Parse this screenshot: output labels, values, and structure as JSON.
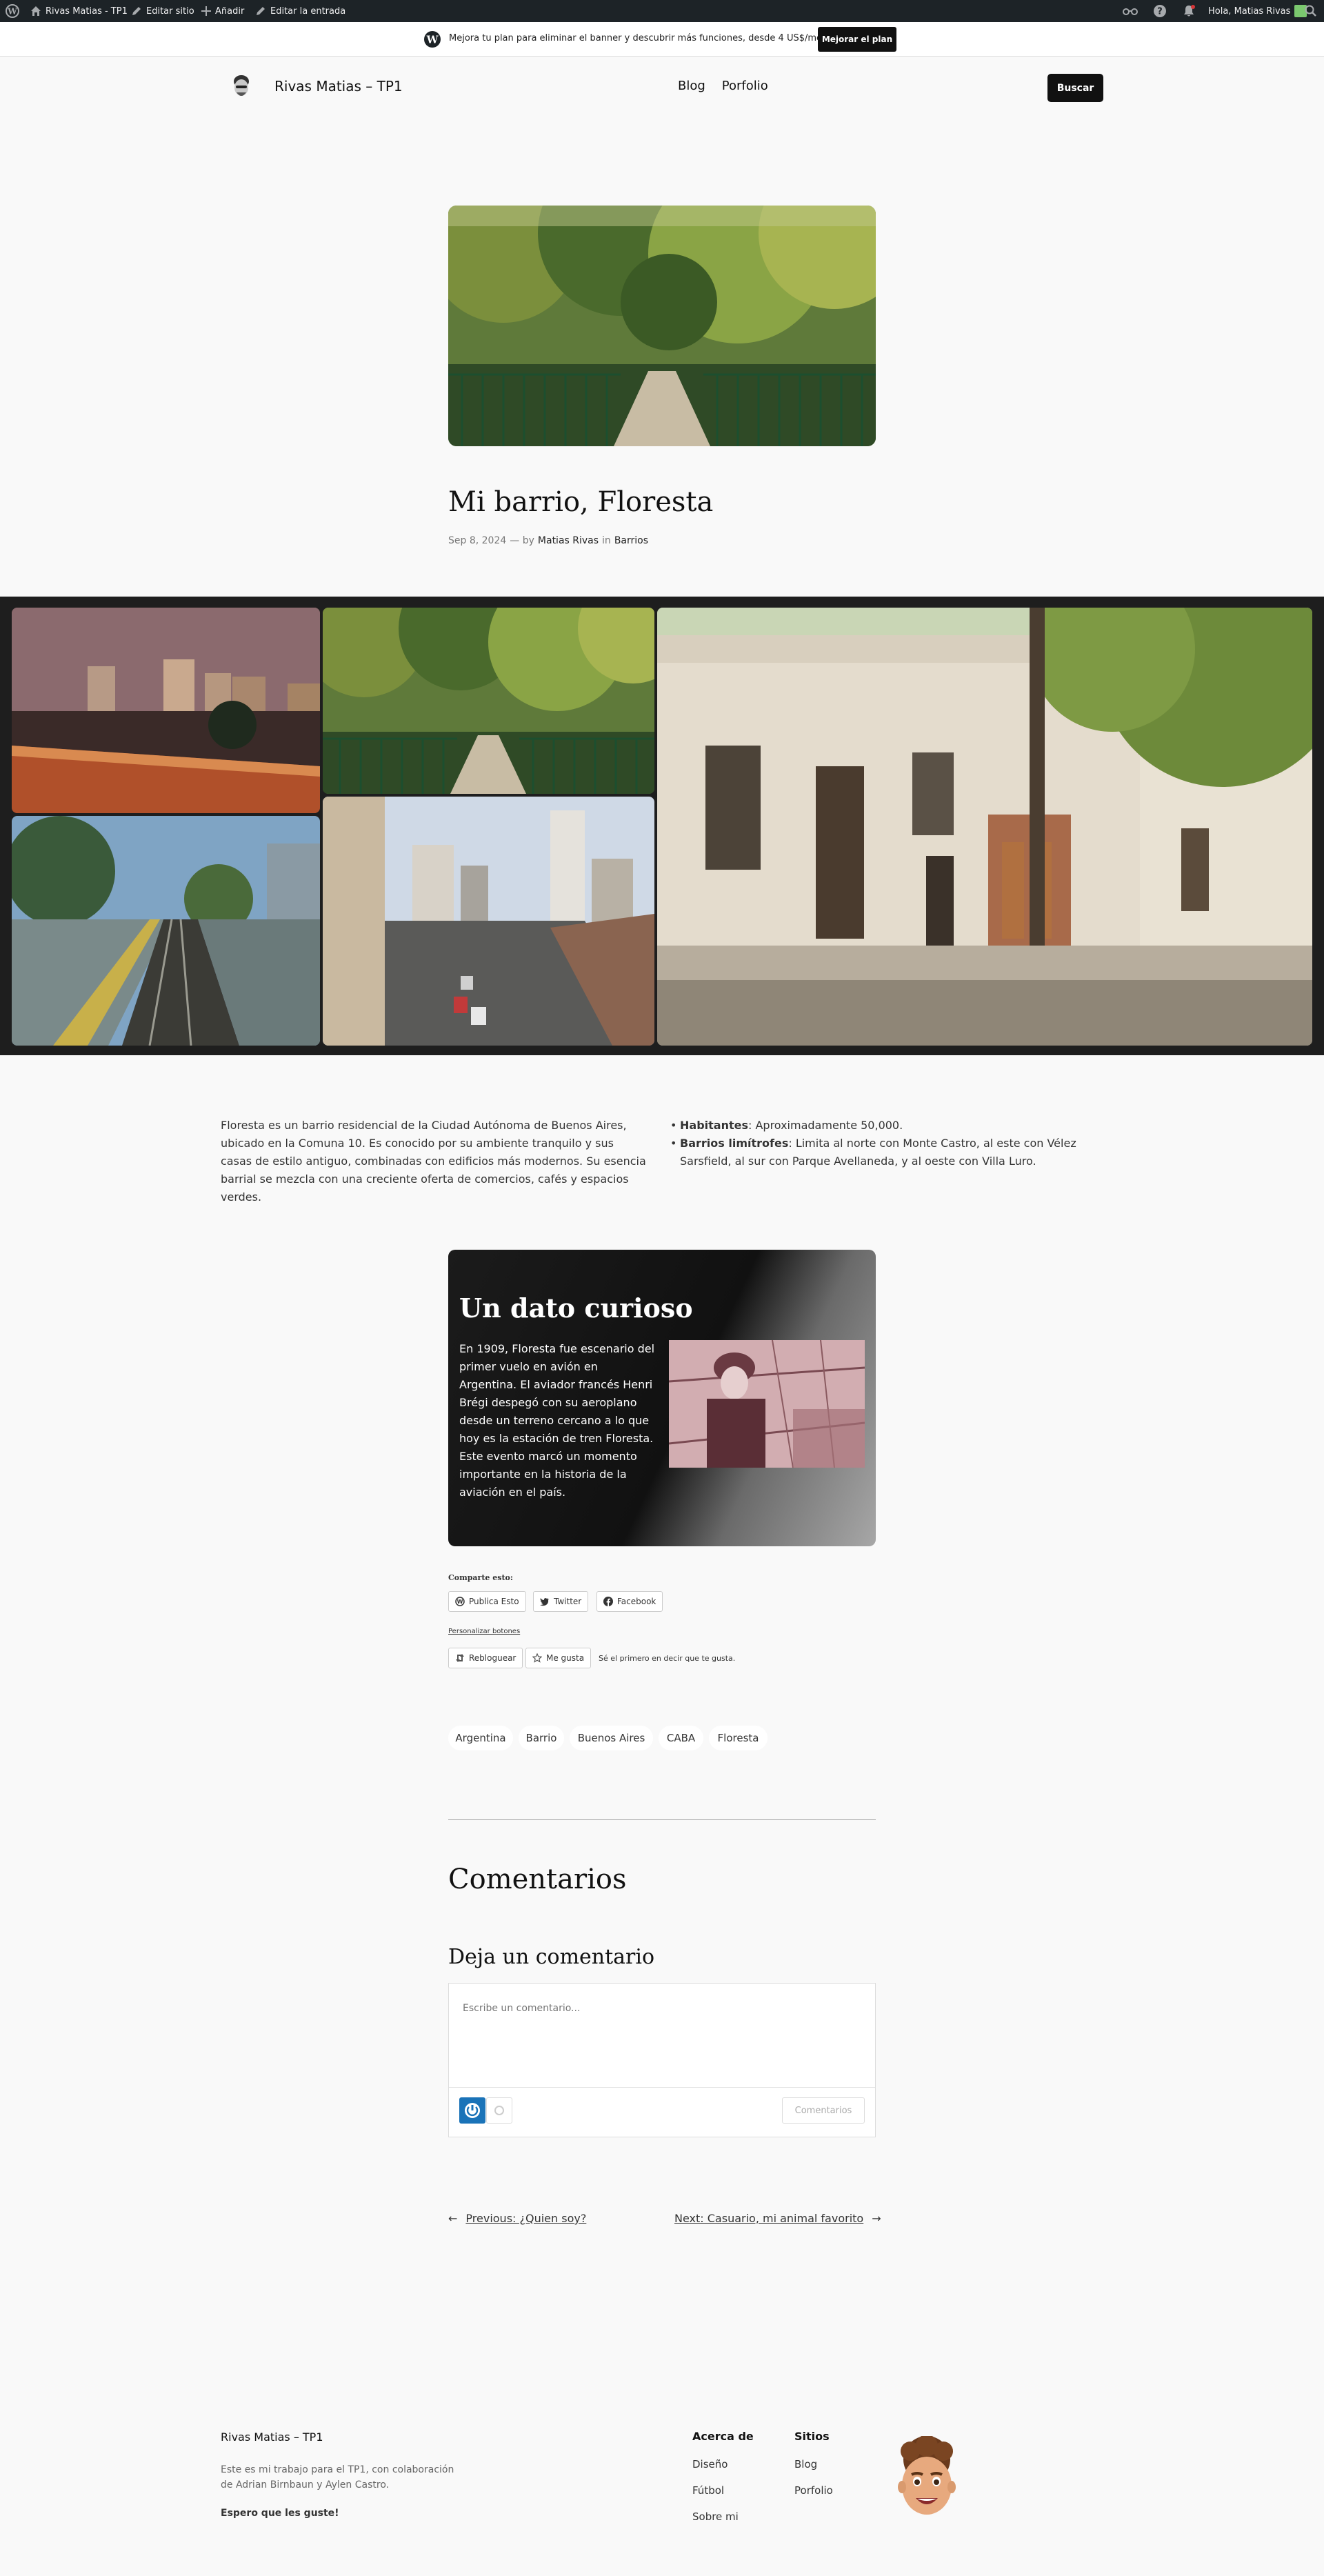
{
  "admin_bar": {
    "site_name": "Rivas Matias - TP1",
    "edit_site": "Editar sitio",
    "add": "Añadir",
    "edit_post": "Editar la entrada",
    "greeting": "Hola, Matias Rivas"
  },
  "banner": {
    "text": "Mejora tu plan para eliminar el banner y descubrir más funciones, desde 4 US$/mes.",
    "button": "Mejorar el plan"
  },
  "header": {
    "site_title": "Rivas Matias – TP1",
    "nav": [
      "Blog",
      "Porfolio"
    ],
    "search_button": "Buscar"
  },
  "post": {
    "title": "Mi barrio, Floresta",
    "date": "Sep 8, 2024",
    "by_text": "— by",
    "author": "Matias Rivas",
    "in_text": "in",
    "category": "Barrios"
  },
  "content": {
    "paragraph": "Floresta es un barrio residencial de la Ciudad Autónoma de Buenos Aires, ubicado en la Comuna 10. Es conocido por su ambiente tranquilo y sus casas de estilo antiguo, combinadas con edificios más modernos. Su esencia barrial se mezcla con una creciente oferta de comercios, cafés y espacios verdes.",
    "list": [
      {
        "label": "Habitantes",
        "text": ": Aproximadamente 50,000."
      },
      {
        "label": "Barrios limítrofes",
        "text": ": Limita al norte con Monte Castro, al este con Vélez Sarsfield, al sur con Parque Avellaneda, y al oeste con Villa Luro."
      }
    ]
  },
  "fact": {
    "title": "Un dato curioso",
    "text": "En 1909, Floresta fue escenario del primer vuelo en avión en Argentina. El aviador francés Henri Brégi despegó con su aeroplano desde un terreno cercano a lo que hoy es la estación de tren Floresta. Este evento marcó un momento importante en la historia de la aviación en el país."
  },
  "share": {
    "heading": "Comparte esto:",
    "buttons": [
      "Publica Esto",
      "Twitter",
      "Facebook"
    ],
    "customize": "Personalizar botones",
    "reblog": "Rebloguear",
    "like": "Me gusta",
    "first_like": "Sé el primero en decir que te gusta."
  },
  "tags": [
    "Argentina",
    "Barrio",
    "Buenos Aires",
    "CABA",
    "Floresta"
  ],
  "comments": {
    "heading": "Comentarios",
    "leave_heading": "Deja un comentario",
    "placeholder": "Escribe un comentario...",
    "submit": "Comentarios"
  },
  "post_nav": {
    "previous": "Previous: ¿Quien soy?",
    "next": "Next: Casuario, mi animal favorito"
  },
  "footer": {
    "site_title": "Rivas Matias – TP1",
    "description": "Este es mi trabajo para el TP1, con colaboración de Adrian Birnbaun y Aylen Castro.",
    "tagline": "Espero que les guste!",
    "col1_title": "Acerca de",
    "col1_links": [
      "Diseño",
      "Fútbol",
      "Sobre mi"
    ],
    "col2_title": "Sitios",
    "col2_links": [
      "Blog",
      "Porfolio"
    ]
  }
}
